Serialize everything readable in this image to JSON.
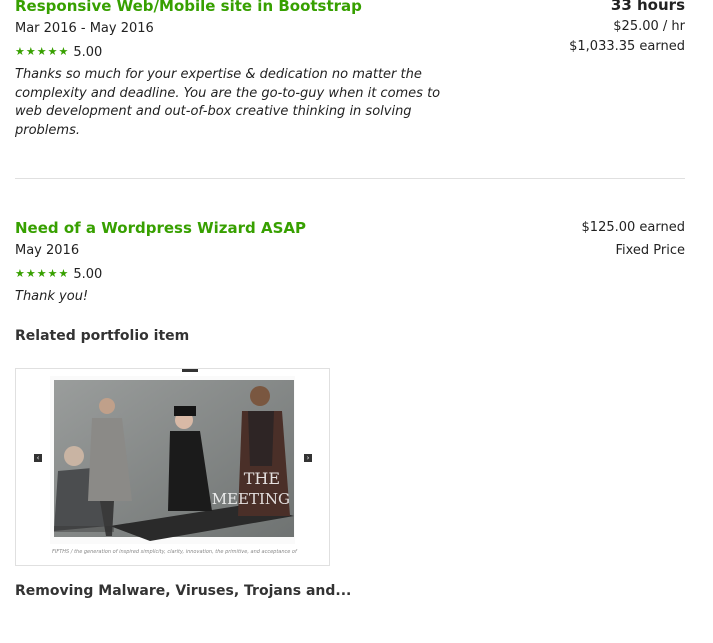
{
  "job1": {
    "title": "Responsive Web/Mobile site in Bootstrap",
    "dates": "Mar 2016 - May 2016",
    "rating": "5.00",
    "feedback": "Thanks so much for your expertise & dedication no matter the complexity and deadline. You are the go-to-guy when it comes to web development and out-of-box creative thinking in solving problems.",
    "hours": "33 hours",
    "rate": "$25.00 / hr",
    "earned": "$1,033.35 earned"
  },
  "job2": {
    "title": "Need of a Wordpress Wizard ASAP",
    "dates": "May 2016",
    "rating": "5.00",
    "feedback": "Thank you!",
    "earned": "$125.00 earned",
    "price_type": "Fixed Price"
  },
  "portfolio": {
    "section_label": "Related portfolio item",
    "image_text": "THE MEETING",
    "caption": "FIFTHS / the generation of inspired simplicity, clarity, innovation, the primitive, and acceptance of",
    "title": "Removing Malware, Viruses, Trojans and..."
  },
  "colors": {
    "accent": "#37a000",
    "text": "#222222",
    "divider": "#e0e0e0"
  },
  "icons": {
    "star": "star-icon",
    "prev": "chevron-left-icon",
    "next": "chevron-right-icon"
  }
}
